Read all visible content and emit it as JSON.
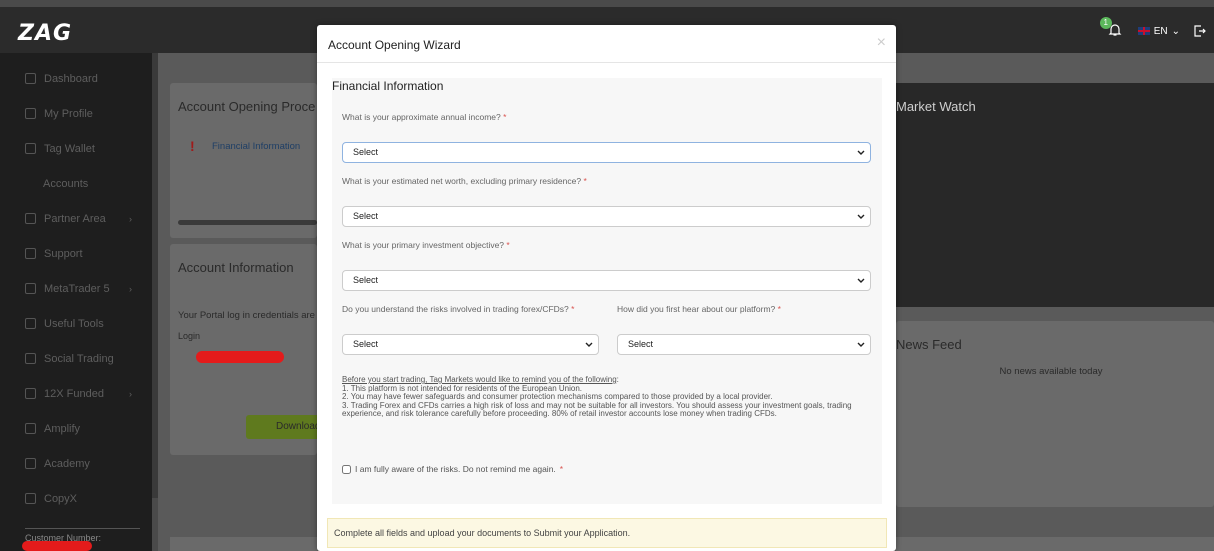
{
  "topbar": {
    "logo": "ZAG",
    "notification_count": "1",
    "language": "EN"
  },
  "sidebar": {
    "items": [
      {
        "label": "Dashboard"
      },
      {
        "label": "My Profile"
      },
      {
        "label": "Tag Wallet"
      },
      {
        "label": "Accounts"
      },
      {
        "label": "Partner Area"
      },
      {
        "label": "Support"
      },
      {
        "label": "MetaTrader 5"
      },
      {
        "label": "Useful Tools"
      },
      {
        "label": "Social Trading"
      },
      {
        "label": "12X Funded"
      },
      {
        "label": "Amplify"
      },
      {
        "label": "Academy"
      },
      {
        "label": "CopyX"
      }
    ],
    "customer_label": "Customer Number:"
  },
  "background": {
    "process_title": "Account Opening Proce",
    "process_step": "Financial Information",
    "info_title": "Account Information",
    "credentials_text": "Your Portal log in credentials are",
    "login_label": "Login",
    "download_label": "Download",
    "market_watch_title": "Market Watch",
    "news_feed_title": "News Feed",
    "news_empty": "No news available today"
  },
  "modal": {
    "title": "Account Opening Wizard",
    "close": "×",
    "section_title": "Financial Information",
    "questions": {
      "income": "What is your approximate annual income?",
      "net_worth": "What is your estimated net worth, excluding primary residence?",
      "objective": "What is your primary investment objective?",
      "risks": "Do you understand the risks involved in trading forex/CFDs?",
      "hear": "How did you first hear about our platform?"
    },
    "required_mark": "*",
    "select_value": "Select",
    "disclaimer": {
      "heading": "Before you start trading, Tag Markets would like to remind you of the following",
      "line1": "1. This platform is not intended for residents of the European Union.",
      "line2": "2. You may have fewer safeguards and consumer protection mechanisms compared to those provided by a local provider.",
      "line3": "3. Trading Forex and CFDs carries a high risk of loss and may not be suitable for all investors. You should assess your investment goals, trading experience, and risk tolerance carefully before proceeding. 80% of retail investor accounts lose money when trading CFDs."
    },
    "checkbox_label": "I am fully aware of the risks. Do not remind me again.",
    "footer_note": "Complete all fields and upload your documents to Submit your Application."
  }
}
